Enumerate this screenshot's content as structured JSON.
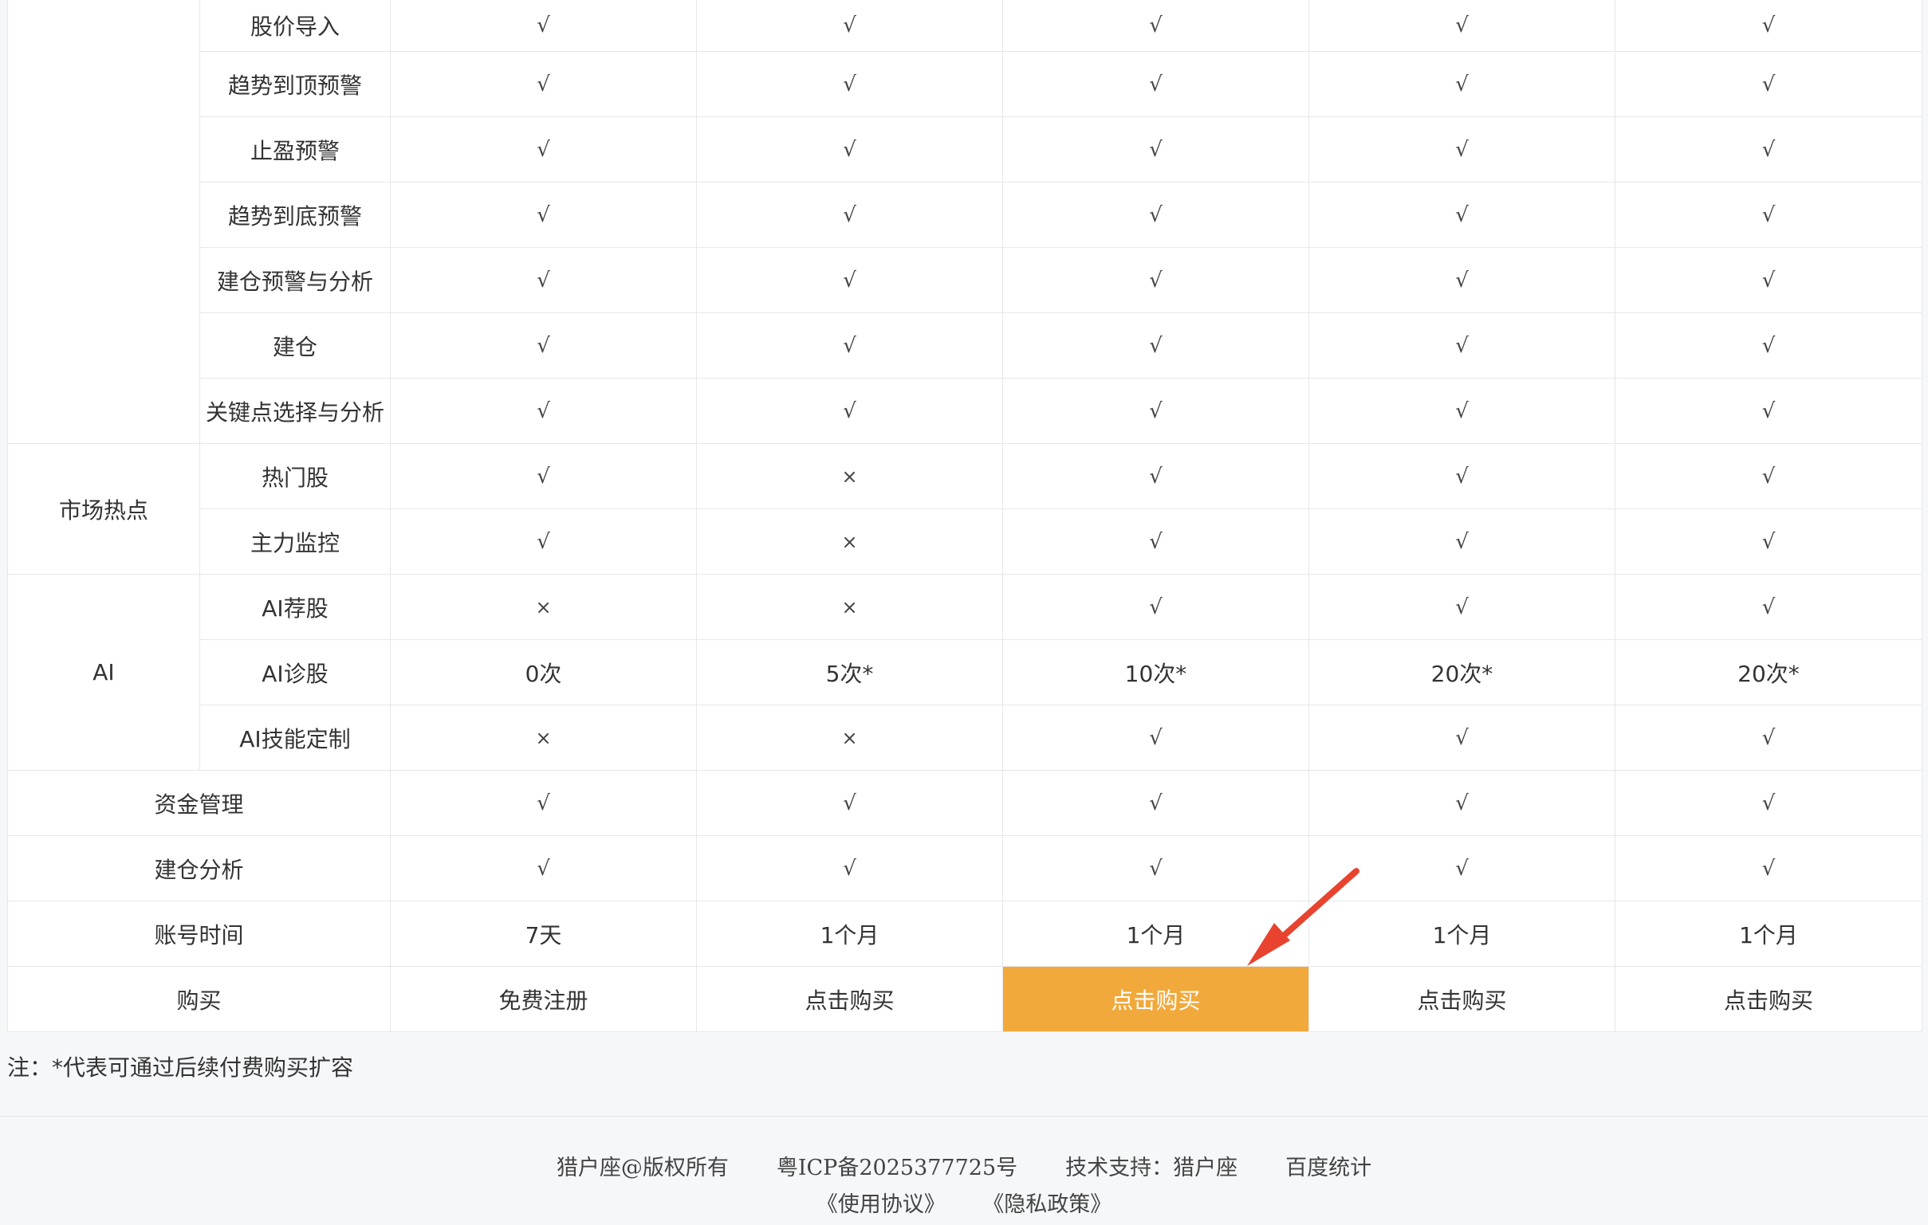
{
  "table": {
    "rows": [
      {
        "feature": "股价导入",
        "cells": [
          "√",
          "√",
          "√",
          "√",
          "√"
        ]
      },
      {
        "feature": "趋势到顶预警",
        "cells": [
          "√",
          "√",
          "√",
          "√",
          "√"
        ]
      },
      {
        "feature": "止盈预警",
        "cells": [
          "√",
          "√",
          "√",
          "√",
          "√"
        ]
      },
      {
        "feature": "趋势到底预警",
        "cells": [
          "√",
          "√",
          "√",
          "√",
          "√"
        ]
      },
      {
        "feature": "建仓预警与分析",
        "cells": [
          "√",
          "√",
          "√",
          "√",
          "√"
        ]
      },
      {
        "feature": "建仓",
        "cells": [
          "√",
          "√",
          "√",
          "√",
          "√"
        ]
      },
      {
        "feature": "关键点选择与分析",
        "cells": [
          "√",
          "√",
          "√",
          "√",
          "√"
        ]
      },
      {
        "group": "市场热点",
        "feature": "热门股",
        "cells": [
          "√",
          "×",
          "√",
          "√",
          "√"
        ]
      },
      {
        "feature": "主力监控",
        "cells": [
          "√",
          "×",
          "√",
          "√",
          "√"
        ]
      },
      {
        "group": "AI",
        "feature": "AI荐股",
        "cells": [
          "×",
          "×",
          "√",
          "√",
          "√"
        ]
      },
      {
        "feature": "AI诊股",
        "cells": [
          "0次",
          "5次*",
          "10次*",
          "20次*",
          "20次*"
        ]
      },
      {
        "feature": "AI技能定制",
        "cells": [
          "×",
          "×",
          "√",
          "√",
          "√"
        ]
      },
      {
        "feature": "资金管理",
        "cells": [
          "√",
          "√",
          "√",
          "√",
          "√"
        ]
      },
      {
        "feature": "建仓分析",
        "cells": [
          "√",
          "√",
          "√",
          "√",
          "√"
        ]
      },
      {
        "feature": "账号时间",
        "cells": [
          "7天",
          "1个月",
          "1个月",
          "1个月",
          "1个月"
        ]
      },
      {
        "feature": "购买",
        "cells": [
          "免费注册",
          "点击购买",
          "点击购买",
          "点击购买",
          "点击购买"
        ]
      }
    ]
  },
  "note": "注：*代表可通过后续付费购买扩容",
  "footer": {
    "copyright": "猎户座@版权所有",
    "icp": "粤ICP备2025377725号",
    "tech_support": "技术支持：猎户座",
    "stats": "百度统计",
    "terms": "《使用协议》",
    "privacy": "《隐私政策》"
  },
  "colors": {
    "highlight_button": "#f2a93b",
    "annotation_arrow": "#e8432f",
    "border": "#e5e7eb"
  }
}
